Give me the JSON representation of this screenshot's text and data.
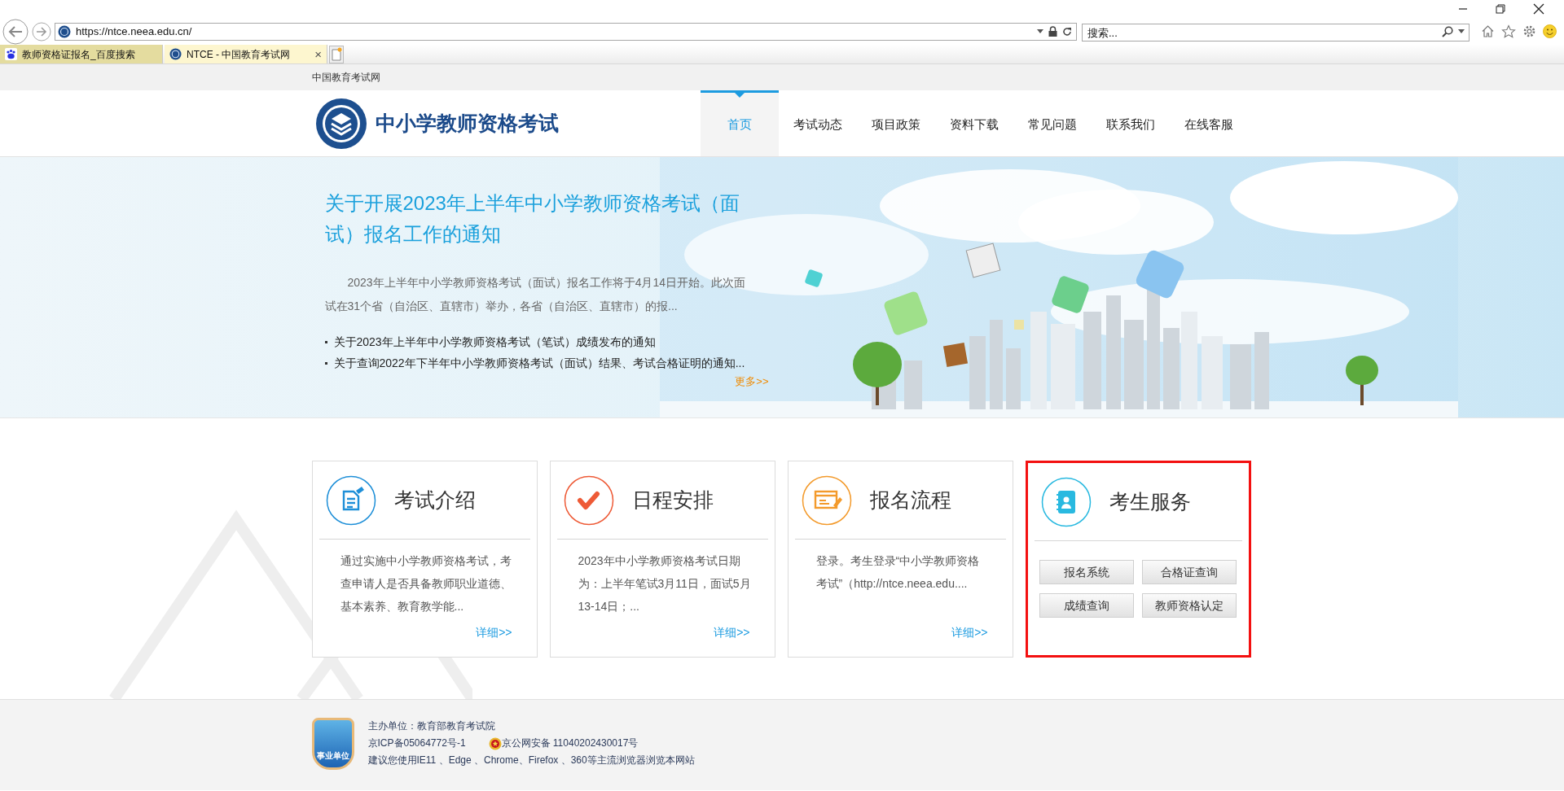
{
  "browser": {
    "address": "https://ntce.neea.edu.cn/",
    "search_placeholder": "搜索...",
    "tabs": [
      {
        "title": "教师资格证报名_百度搜索",
        "selected": false
      },
      {
        "title": "NTCE - 中国教育考试网",
        "selected": true
      }
    ],
    "close_glyph": "×"
  },
  "top_bar": {
    "label": "中国教育考试网"
  },
  "header": {
    "site_title": "中小学教师资格考试",
    "nav": [
      {
        "label": "首页",
        "selected": true
      },
      {
        "label": "考试动态",
        "selected": false
      },
      {
        "label": "项目政策",
        "selected": false
      },
      {
        "label": "资料下载",
        "selected": false
      },
      {
        "label": "常见问题",
        "selected": false
      },
      {
        "label": "联系我们",
        "selected": false
      },
      {
        "label": "在线客服",
        "selected": false
      }
    ]
  },
  "banner": {
    "headline": "关于开展2023年上半年中小学教师资格考试（面试）报名工作的通知",
    "summary": "2023年上半年中小学教师资格考试（面试）报名工作将于4月14日开始。此次面试在31个省（自治区、直辖市）举办，各省（自治区、直辖市）的报...",
    "news": [
      "关于2023年上半年中小学教师资格考试（笔试）成绩发布的通知",
      "关于查询2022年下半年中小学教师资格考试（面试）结果、考试合格证明的通知..."
    ],
    "more": "更多>>"
  },
  "cards": [
    {
      "kind": "text",
      "title": "考试介绍",
      "color": "#1e8fd8",
      "highlighted": false,
      "body": "通过实施中小学教师资格考试，考查申请人是否具备教师职业道德、基本素养、教育教学能...",
      "link": "详细>>"
    },
    {
      "kind": "text",
      "title": "日程安排",
      "color": "#ee5a36",
      "highlighted": false,
      "body": "2023年中小学教师资格考试日期为：上半年笔试3月11日，面试5月13-14日；...",
      "link": "详细>>"
    },
    {
      "kind": "text",
      "title": "报名流程",
      "color": "#f39a2b",
      "highlighted": false,
      "body": "登录。考生登录“中小学教师资格考试”（http://ntce.neea.edu....",
      "link": "详细>>"
    },
    {
      "kind": "buttons",
      "title": "考生服务",
      "color": "#29b9e0",
      "highlighted": true,
      "buttons": [
        "报名系统",
        "合格证查询",
        "成绩查询",
        "教师资格认定"
      ]
    }
  ],
  "footer": {
    "badge_text": "事业单位",
    "sponsor": "主办单位：教育部教育考试院",
    "icp": "京ICP备05064772号-1",
    "police": "京公网安备 11040202430017号",
    "browsers": "建议您使用IE11 、Edge 、Chrome、Firefox 、360等主流浏览器浏览本网站"
  }
}
